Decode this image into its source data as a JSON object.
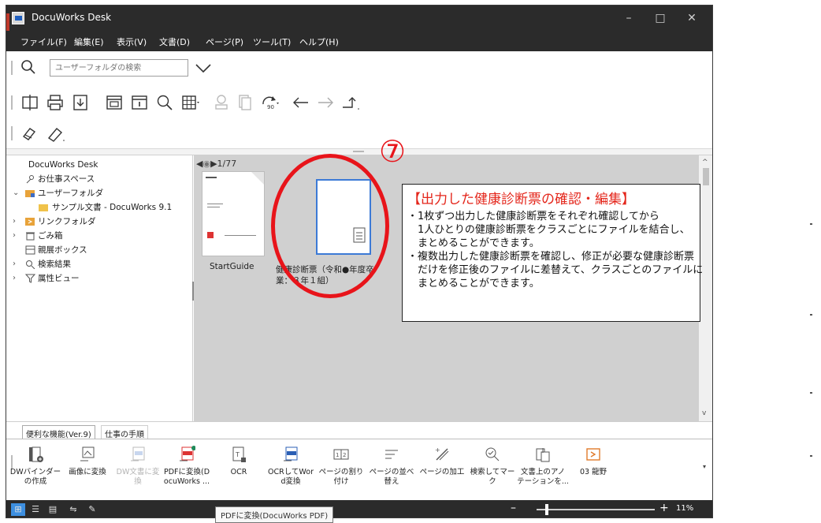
{
  "window": {
    "title": "DocuWorks Desk",
    "controls": {
      "minimize": "–",
      "maximize": "□",
      "close": "✕"
    }
  },
  "menu": [
    "ファイル(F)",
    "編集(E)",
    "表示(V)",
    "文書(D)",
    "ページ(P)",
    "ツール(T)",
    "ヘルプ(H)"
  ],
  "search": {
    "placeholder": "ユーザーフォルダの検索"
  },
  "toolbar": {
    "icons": [
      "split-icon",
      "print-icon",
      "download-icon",
      "binder-icon",
      "info-icon",
      "search-icon",
      "grid-icon",
      "stamp-icon",
      "copy-icon",
      "rotate-icon",
      "back-arrow-icon",
      "forward-arrow-icon",
      "up-arrow-icon"
    ],
    "row3_icons": [
      "annotation-icon",
      "eraser-icon"
    ]
  },
  "tree": {
    "root": "DocuWorks Desk",
    "items": [
      {
        "label": "お仕事スペース",
        "icon": "workspace-icon"
      },
      {
        "label": "ユーザーフォルダ",
        "icon": "user-folder-icon",
        "expanded": true
      },
      {
        "label": "サンプル文書 - DocuWorks 9.1",
        "icon": "folder-icon"
      },
      {
        "label": "リンクフォルダ",
        "icon": "link-folder-icon"
      },
      {
        "label": "ごみ箱",
        "icon": "trash-icon"
      },
      {
        "label": "親展ボックス",
        "icon": "confidential-box-icon"
      },
      {
        "label": "検索結果",
        "icon": "search-results-icon"
      },
      {
        "label": "属性ビュー",
        "icon": "filter-icon"
      }
    ]
  },
  "document_view": {
    "pager": "1/77",
    "documents": [
      {
        "caption": "StartGuide"
      },
      {
        "caption": "健康診断票（令和●年度卒\n業：３年１組）"
      }
    ]
  },
  "annotation": {
    "marker": "⑦",
    "title": "【出力した健康診断票の確認・編集】",
    "lines": [
      "・1枚ずつ出力した健康診断票をそれぞれ確認してから",
      "　1人ひとりの健康診断票をクラスごとにファイルを結合し、",
      "　まとめることができます。",
      "・複数出力した健康診断票を確認し、修正が必要な健康診断票",
      "　だけを修正後のファイルに差替えて、クラスごとのファイルに",
      "　まとめることができます。"
    ]
  },
  "bottom_tabs": [
    "便利な機能(Ver.9)",
    "仕事の手順"
  ],
  "functions": [
    {
      "label": "DWバインダー\nの作成",
      "enabled": true
    },
    {
      "label": "画像に変換",
      "enabled": true
    },
    {
      "label": "DW文書に変\n換",
      "enabled": false
    },
    {
      "label": "PDFに変換(D\nocuWorks ...",
      "enabled": true
    },
    {
      "label": "OCR",
      "enabled": true
    },
    {
      "label": "OCRしてWor\nd変換",
      "enabled": true
    },
    {
      "label": "ページの割り\n付け",
      "enabled": true
    },
    {
      "label": "ページの並べ\n替え",
      "enabled": true
    },
    {
      "label": "ページの加工",
      "enabled": true
    },
    {
      "label": "検索してマーク",
      "enabled": true
    },
    {
      "label": "文書上のアノ\nテーションを...",
      "enabled": true
    },
    {
      "label": "03 龍野",
      "enabled": true
    }
  ],
  "status": {
    "zoom": "11%",
    "tooltip": "PDFに変換(DocuWorks PDF)"
  },
  "colors": {
    "accent_red": "#e8141a",
    "title_bar": "#2b2b2b"
  }
}
